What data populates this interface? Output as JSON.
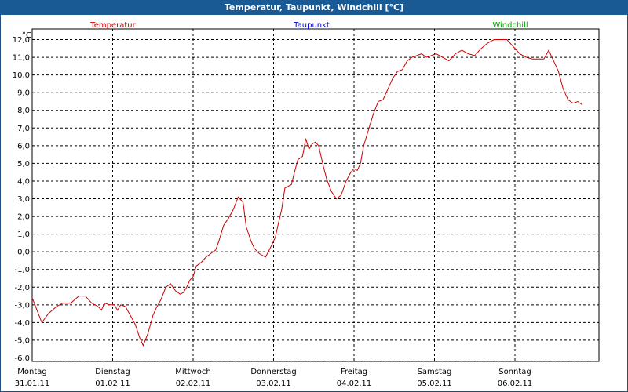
{
  "window": {
    "title": "Temperatur, Taupunkt, Windchill [°C]"
  },
  "colors": {
    "titlebar": "#1a5a94",
    "temperature": "#cc0000",
    "dewpoint": "#0000cc",
    "windchill": "#00aa00"
  },
  "chart_data": {
    "type": "line",
    "title": "Temperatur, Taupunkt, Windchill [°C]",
    "ylabel": "°C",
    "ylim": [
      -6.2,
      12.6
    ],
    "yticks": [
      "12,0",
      "11,0",
      "10,0",
      "9,0",
      "8,0",
      "7,0",
      "6,0",
      "5,0",
      "4,0",
      "3,0",
      "2,0",
      "1,0",
      "0,0",
      "-1,0",
      "-2,0",
      "-3,0",
      "-4,0",
      "-5,0",
      "-6,0"
    ],
    "legend": [
      "Temperatur",
      "Taupunkt",
      "Windchill"
    ],
    "x_labels": [
      {
        "day": "Montag",
        "date": "31.01.11"
      },
      {
        "day": "Dienstag",
        "date": "01.02.11"
      },
      {
        "day": "Mittwoch",
        "date": "02.02.11"
      },
      {
        "day": "Donnerstag",
        "date": "03.02.11"
      },
      {
        "day": "Freitag",
        "date": "04.02.11"
      },
      {
        "day": "Samstag",
        "date": "05.02.11"
      },
      {
        "day": "Sonntag",
        "date": "06.02.11"
      }
    ],
    "grid": true,
    "series": [
      {
        "name": "Temperatur",
        "x_days": [
          0,
          0.06,
          0.12,
          0.2,
          0.3,
          0.38,
          0.48,
          0.58,
          0.66,
          0.74,
          0.82,
          0.86,
          0.9,
          0.96,
          1.02,
          1.06,
          1.1,
          1.16,
          1.22,
          1.28,
          1.34,
          1.38,
          1.44,
          1.5,
          1.54,
          1.6,
          1.66,
          1.72,
          1.78,
          1.84,
          1.88,
          1.92,
          1.96,
          2.0,
          2.04,
          2.1,
          2.16,
          2.22,
          2.28,
          2.32,
          2.38,
          2.44,
          2.5,
          2.56,
          2.62,
          2.66,
          2.72,
          2.76,
          2.82,
          2.9,
          2.98,
          3.02,
          3.06,
          3.1,
          3.14,
          3.18,
          3.22,
          3.26,
          3.3,
          3.36,
          3.4,
          3.44,
          3.48,
          3.52,
          3.56,
          3.62,
          3.66,
          3.72,
          3.78,
          3.84,
          3.9,
          3.96,
          4.0,
          4.04,
          4.08,
          4.12,
          4.18,
          4.24,
          4.3,
          4.36,
          4.42,
          4.48,
          4.54,
          4.6,
          4.66,
          4.72,
          4.78,
          4.84,
          4.9,
          4.96,
          5.02,
          5.1,
          5.18,
          5.26,
          5.34,
          5.42,
          5.5,
          5.58,
          5.66,
          5.74,
          5.82,
          5.9,
          5.98,
          6.06,
          6.14,
          6.22,
          6.3,
          6.36,
          6.42,
          6.48,
          6.54,
          6.6,
          6.66,
          6.72,
          6.78,
          6.84,
          6.9,
          6.96
        ],
        "values": [
          -2.6,
          -3.3,
          -4.0,
          -3.5,
          -3.1,
          -2.9,
          -2.9,
          -2.5,
          -2.5,
          -2.9,
          -3.1,
          -3.3,
          -2.9,
          -3.0,
          -3.0,
          -3.3,
          -3.0,
          -3.1,
          -3.6,
          -4.1,
          -4.9,
          -5.3,
          -4.6,
          -3.6,
          -3.2,
          -2.7,
          -2.0,
          -1.8,
          -2.2,
          -2.4,
          -2.3,
          -2.0,
          -1.6,
          -1.4,
          -0.8,
          -0.6,
          -0.3,
          -0.1,
          0.1,
          0.6,
          1.5,
          1.9,
          2.4,
          3.1,
          2.8,
          1.4,
          0.6,
          0.2,
          -0.1,
          -0.3,
          0.4,
          0.8,
          1.6,
          2.4,
          3.6,
          3.7,
          3.8,
          4.5,
          5.2,
          5.4,
          6.4,
          5.8,
          6.1,
          6.2,
          6.0,
          4.8,
          4.1,
          3.4,
          3.0,
          3.2,
          4.0,
          4.5,
          4.7,
          4.6,
          5.0,
          6.0,
          6.9,
          7.8,
          8.5,
          8.6,
          9.2,
          9.8,
          10.2,
          10.3,
          10.8,
          11.0,
          11.1,
          11.2,
          11.0,
          11.1,
          11.2,
          11.0,
          10.8,
          11.2,
          11.4,
          11.2,
          11.1,
          11.5,
          11.8,
          12.0,
          12.0,
          12.0,
          11.6,
          11.2,
          11.0,
          10.9,
          10.9,
          10.9,
          11.4,
          10.8,
          10.2,
          9.2,
          8.6,
          8.4,
          8.5,
          8.3
        ]
      }
    ]
  }
}
